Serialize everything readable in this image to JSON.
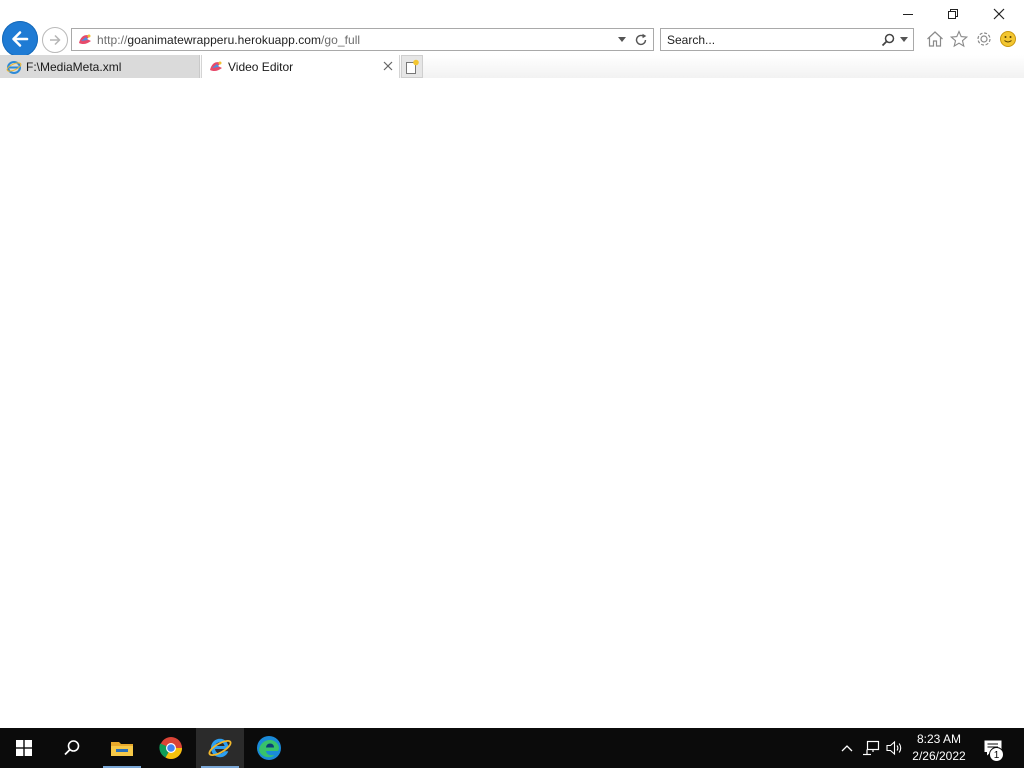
{
  "browser": {
    "address_bar": {
      "url_scheme": "http://",
      "url_host": "goanimatewrapperu.herokuapp.com",
      "url_path": "/go_full"
    },
    "search": {
      "placeholder": "Search..."
    },
    "tabs": [
      {
        "label": "F:\\MediaMeta.xml",
        "icon": "ie-icon",
        "active": false
      },
      {
        "label": "Video Editor",
        "icon": "site-icon",
        "active": true
      }
    ],
    "command_icons": [
      "home-icon",
      "favorites-star-icon",
      "tools-gear-icon",
      "feedback-smiley-icon"
    ]
  },
  "taskbar": {
    "apps": [
      "windows-start-icon",
      "search-icon",
      "file-explorer-icon",
      "chrome-icon",
      "internet-explorer-icon",
      "edge-icon"
    ],
    "clock": {
      "time": "8:23 AM",
      "date": "2/26/2022"
    },
    "notifications_count": "1"
  },
  "colors": {
    "back_button": "#1f7bd4",
    "taskbar": "#0b0b0b",
    "tab_inactive": "#dadada"
  }
}
